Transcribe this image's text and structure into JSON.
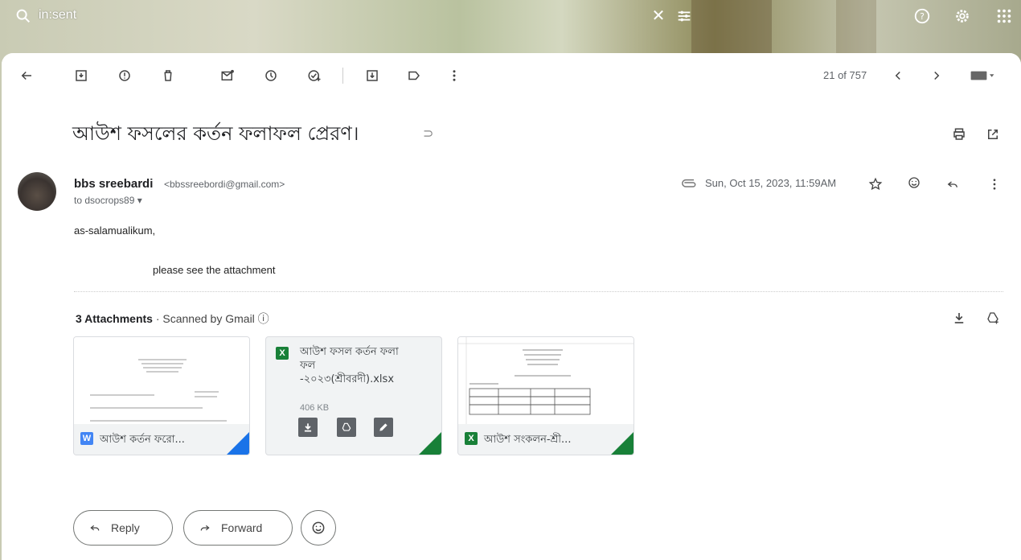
{
  "search": {
    "query": "in:sent"
  },
  "toolbar": {
    "pager": "21 of 757"
  },
  "email": {
    "subject": "আউশ ফসলের কর্তন ফলাফল প্রেরণ।",
    "sender_name": "bbs sreebardi",
    "sender_email": "<bbssreebordi@gmail.com>",
    "to": "to dsocrops89 ▾",
    "date": "Sun, Oct 15, 2023, 11:59AM",
    "body_line1": "as-salamualikum,",
    "body_line2": "please see the attachment"
  },
  "attachments": {
    "count_label": "3 Attachments",
    "scanned_label": "· Scanned by Gmail ⓘ",
    "items": [
      {
        "name": "আউশ কর্তন ফরো...",
        "type": "W"
      },
      {
        "name_line1": "আউশ ফসল কর্তন ফলা",
        "name_line2": "ফল",
        "name_line3": "-২০২৩(শ্রীবরদী).xlsx",
        "size": "406 KB",
        "type": "X"
      },
      {
        "name": "আউশ সংকলন-শ্রী...",
        "type": "X"
      }
    ]
  },
  "actions": {
    "reply": "Reply",
    "forward": "Forward"
  },
  "colors": {
    "word": "#4285f4",
    "excel": "#188038",
    "accent_blue": "#1a73e8"
  }
}
